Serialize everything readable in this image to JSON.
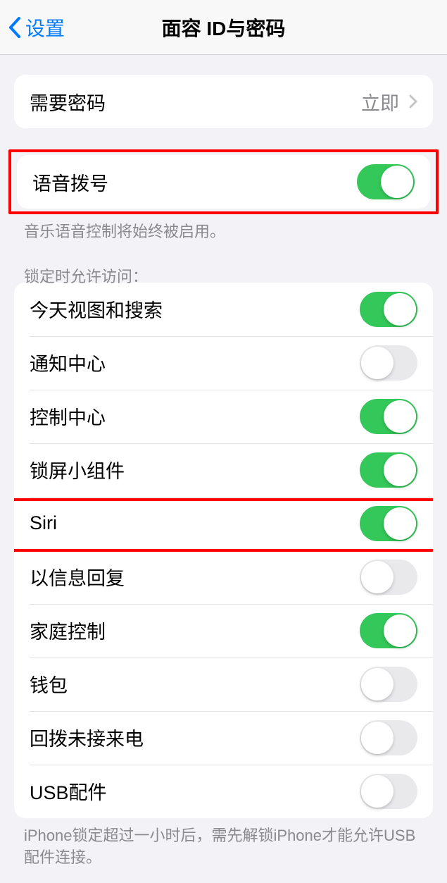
{
  "navbar": {
    "back_label": "设置",
    "title": "面容 ID与密码"
  },
  "require_passcode": {
    "label": "需要密码",
    "value": "立即"
  },
  "voice_dial": {
    "label": "语音拨号",
    "on": true,
    "footer": "音乐语音控制将始终被启用。"
  },
  "lock_access": {
    "header": "锁定时允许访问：",
    "items": [
      {
        "label": "今天视图和搜索",
        "on": true
      },
      {
        "label": "通知中心",
        "on": false
      },
      {
        "label": "控制中心",
        "on": true
      },
      {
        "label": "锁屏小组件",
        "on": true
      },
      {
        "label": "Siri",
        "on": true
      },
      {
        "label": "以信息回复",
        "on": false
      },
      {
        "label": "家庭控制",
        "on": true
      },
      {
        "label": "钱包",
        "on": false
      },
      {
        "label": "回拨未接来电",
        "on": false
      },
      {
        "label": "USB配件",
        "on": false
      }
    ],
    "footer": "iPhone锁定超过一小时后，需先解锁iPhone才能允许USB配件连接。"
  }
}
